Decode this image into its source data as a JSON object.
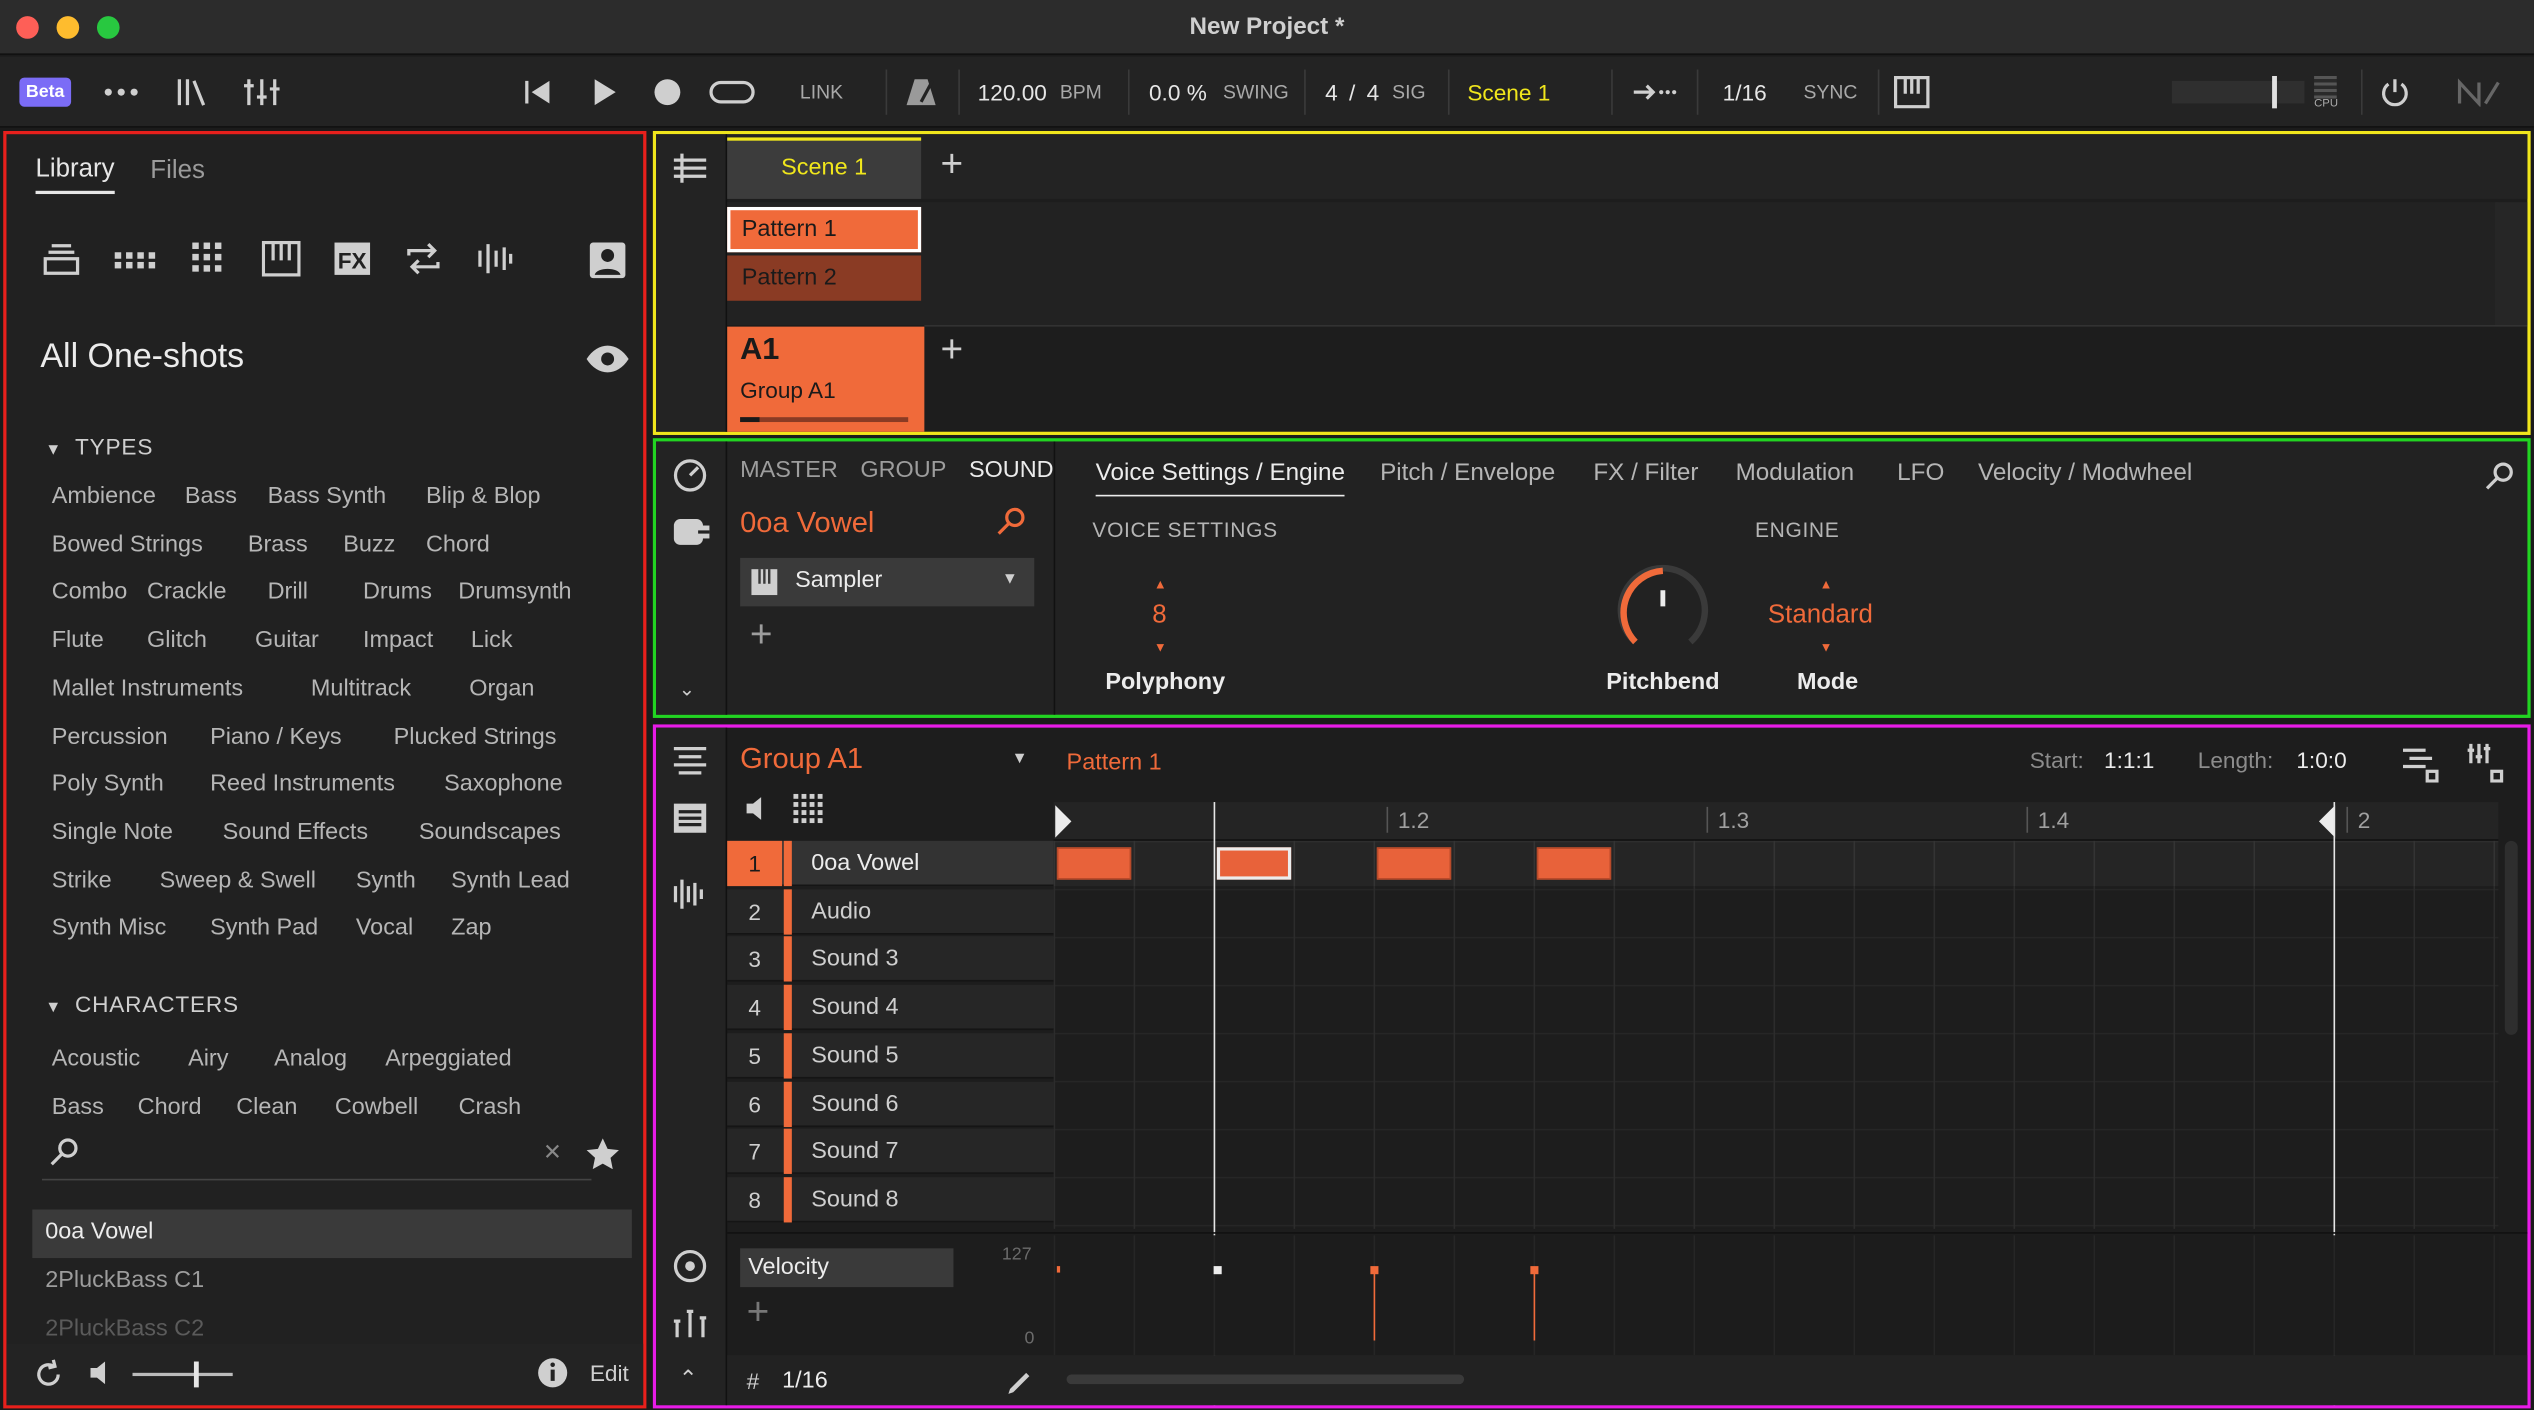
{
  "window": {
    "title": "New Project *"
  },
  "toolbar": {
    "beta": "Beta",
    "link": "LINK",
    "tempo": "120.00",
    "tempo_unit": "BPM",
    "swing": "0.0 %",
    "swing_label": "SWING",
    "sig_num": "4",
    "sig_slash": "/",
    "sig_den": "4",
    "sig_label": "SIG",
    "scene": "Scene 1",
    "quant": "1/16",
    "sync": "SYNC",
    "cpu": "CPU"
  },
  "library": {
    "tabs": [
      "Library",
      "Files"
    ],
    "heading": "All One-shots",
    "types_header": "TYPES",
    "types": [
      "Ambience",
      "Bass",
      "Bass Synth",
      "Blip & Blop",
      "Bowed Strings",
      "Brass",
      "Buzz",
      "Chord",
      "Combo",
      "Crackle",
      "Drill",
      "Drums",
      "Drumsynth",
      "Flute",
      "Glitch",
      "Guitar",
      "Impact",
      "Lick",
      "Mallet Instruments",
      "Multitrack",
      "Organ",
      "Percussion",
      "Piano / Keys",
      "Plucked Strings",
      "Poly Synth",
      "Reed Instruments",
      "Saxophone",
      "Single Note",
      "Sound Effects",
      "Soundscapes",
      "Strike",
      "Sweep & Swell",
      "Synth",
      "Synth Lead",
      "Synth Misc",
      "Synth Pad",
      "Vocal",
      "Zap"
    ],
    "characters_header": "CHARACTERS",
    "characters": [
      "Acoustic",
      "Airy",
      "Analog",
      "Arpeggiated",
      "Bass",
      "Chord",
      "Clean",
      "Cowbell",
      "Crash"
    ],
    "results": [
      "0oa Vowel",
      "2PluckBass C1",
      "2PluckBass C2"
    ],
    "edit": "Edit"
  },
  "arranger": {
    "scene": "Scene 1",
    "patterns": [
      "Pattern 1",
      "Pattern 2"
    ],
    "group_id": "A1",
    "group_name": "Group A1"
  },
  "sound_panel": {
    "tabs_left": [
      "MASTER",
      "GROUP",
      "SOUND"
    ],
    "sound_name": "0oa Vowel",
    "engine": "Sampler",
    "tabs": [
      "Voice Settings / Engine",
      "Pitch / Envelope",
      "FX / Filter",
      "Modulation",
      "LFO",
      "Velocity / Modwheel"
    ],
    "voice_settings": "VOICE SETTINGS",
    "engine_label": "ENGINE",
    "polyphony_value": "8",
    "polyphony": "Polyphony",
    "pitchbend": "Pitchbend",
    "mode_value": "Standard",
    "mode": "Mode",
    "pitchbend_level": 0.5
  },
  "pattern_editor": {
    "group": "Group A1",
    "pattern": "Pattern 1",
    "start_label": "Start:",
    "start": "1:1:1",
    "length_label": "Length:",
    "length": "1:0:0",
    "ruler": [
      "1.2",
      "1.3",
      "1.4",
      "2"
    ],
    "sounds": [
      {
        "n": "1",
        "name": "0oa Vowel"
      },
      {
        "n": "2",
        "name": "Audio"
      },
      {
        "n": "3",
        "name": "Sound 3"
      },
      {
        "n": "4",
        "name": "Sound 4"
      },
      {
        "n": "5",
        "name": "Sound 5"
      },
      {
        "n": "6",
        "name": "Sound 6"
      },
      {
        "n": "7",
        "name": "Sound 7"
      },
      {
        "n": "8",
        "name": "Sound 8"
      }
    ],
    "velocity_label": "Velocity",
    "vel_max": "127",
    "vel_min": "0",
    "grid": "1/16"
  },
  "colors": {
    "accent": "#f06a3a",
    "scene_yellow": "#f0e61c",
    "beta": "#7b6cf6"
  }
}
